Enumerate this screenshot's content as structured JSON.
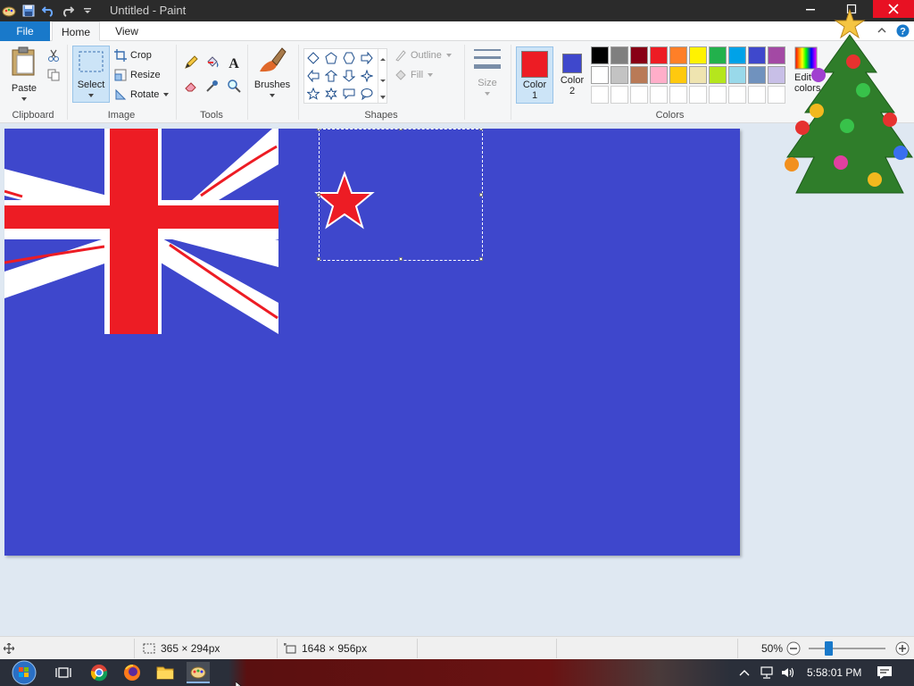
{
  "window": {
    "title": "Untitled - Paint"
  },
  "tabs": [
    {
      "label": "File"
    },
    {
      "label": "Home"
    },
    {
      "label": "View"
    }
  ],
  "clipboard": {
    "paste_label": "Paste",
    "group_label": "Clipboard"
  },
  "image": {
    "select_label": "Select",
    "crop_label": "Crop",
    "resize_label": "Resize",
    "rotate_label": "Rotate",
    "group_label": "Image"
  },
  "tools": {
    "group_label": "Tools",
    "brushes_label": "Brushes"
  },
  "shapes": {
    "outline_label": "Outline",
    "fill_label": "Fill",
    "group_label": "Shapes"
  },
  "size": {
    "label": "Size"
  },
  "colors": {
    "color1_label": "Color",
    "color1_num": "1",
    "color2_label": "Color",
    "color2_num": "2",
    "color1_value": "#ed1c24",
    "color2_value": "#3f48cc",
    "edit_label": "Edit",
    "edit_label2": "colors",
    "group_label": "Colors",
    "palette_row1": [
      "#000000",
      "#7f7f7f",
      "#880015",
      "#ed1c24",
      "#ff7f27",
      "#fff200",
      "#22b14c",
      "#00a2e8",
      "#3f48cc",
      "#a349a4"
    ],
    "palette_row2": [
      "#ffffff",
      "#c3c3c3",
      "#b97a57",
      "#ffaec9",
      "#ffc90e",
      "#efe4b0",
      "#b5e61d",
      "#99d9ea",
      "#7092be",
      "#c8bfe7"
    ],
    "palette_row3": [
      "#ffffff",
      "#ffffff",
      "#ffffff",
      "#ffffff",
      "#ffffff",
      "#ffffff",
      "#ffffff",
      "#ffffff",
      "#ffffff",
      "#ffffff"
    ]
  },
  "canvas": {
    "background": "#3e47cc",
    "cross_color": "#ed1c24",
    "star_color": "#ed1c24"
  },
  "status": {
    "selection_size": "365 × 294px",
    "image_size": "1648 × 956px",
    "zoom": "50%"
  },
  "taskbar": {
    "clock": "5:58:01 PM"
  }
}
